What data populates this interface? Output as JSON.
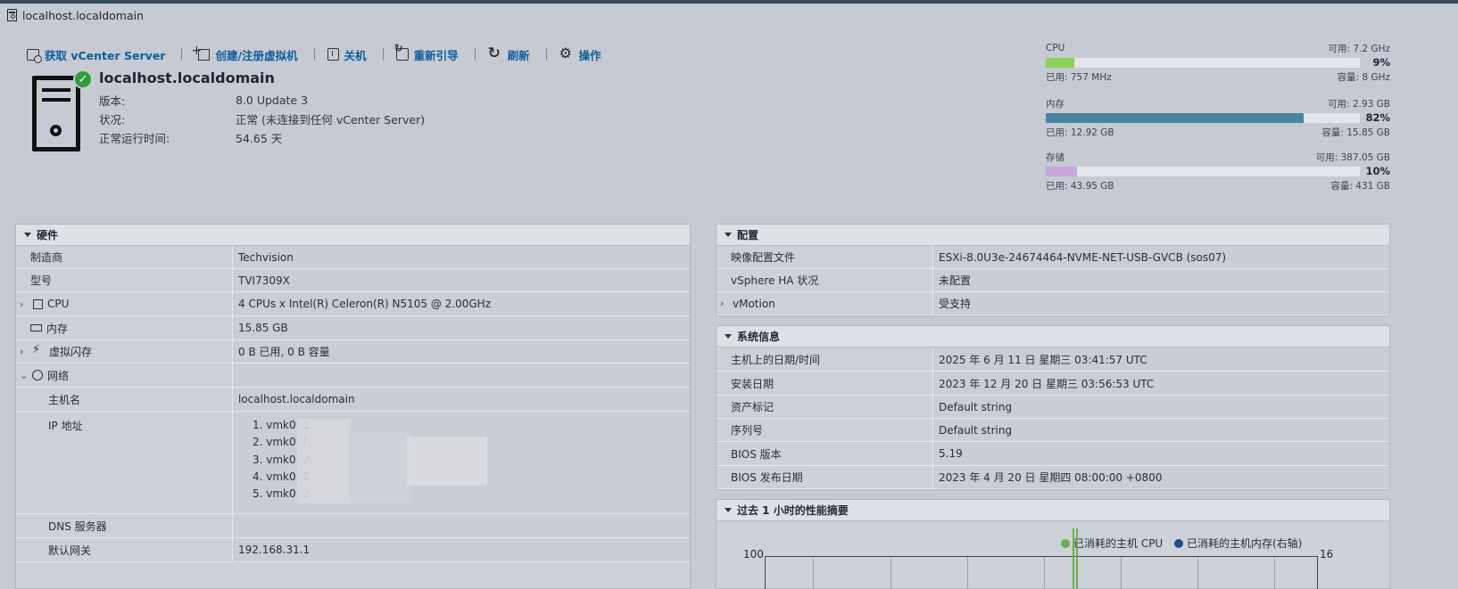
{
  "window": {
    "title": "localhost.localdomain"
  },
  "toolbar": {
    "get_vcenter": "获取 vCenter Server",
    "create_vm": "创建/注册虚拟机",
    "shutdown": "关机",
    "reboot": "重新引导",
    "refresh": "刷新",
    "actions": "操作"
  },
  "host": {
    "name": "localhost.localdomain",
    "status_color": "#2e9e3a",
    "info": [
      {
        "label": "版本:",
        "value": "8.0 Update 3"
      },
      {
        "label": "状况:",
        "value": "正常 (未连接到任何 vCenter Server)"
      },
      {
        "label": "正常运行时间:",
        "value": "54.65 天"
      }
    ]
  },
  "resources": {
    "cpu": {
      "label": "CPU",
      "free": "可用: 7.2 GHz",
      "percent": 9,
      "percent_label": "9%",
      "used": "已用: 757 MHz",
      "capacity": "容量: 8 GHz",
      "color": "#8bd35a"
    },
    "memory": {
      "label": "内存",
      "free": "可用: 2.93 GB",
      "percent": 82,
      "percent_label": "82%",
      "used": "已用: 12.92 GB",
      "capacity": "容量: 15.85 GB",
      "color": "#4a86a2"
    },
    "storage": {
      "label": "存储",
      "free": "可用: 387.05 GB",
      "percent": 10,
      "percent_label": "10%",
      "used": "已用: 43.95 GB",
      "capacity": "容量: 431 GB",
      "color": "#c8a6dc"
    }
  },
  "hardware": {
    "title": "硬件",
    "rows": {
      "manufacturer": {
        "label": "制造商",
        "value": "Techvision"
      },
      "model": {
        "label": "型号",
        "value": "TVI7309X"
      },
      "cpu": {
        "label": "CPU",
        "value": "4 CPUs x Intel(R) Celeron(R) N5105 @ 2.00GHz"
      },
      "memory": {
        "label": "内存",
        "value": "15.85 GB"
      },
      "flash": {
        "label": "虚拟闪存",
        "value": "0 B 已用, 0 B 容量"
      },
      "network": {
        "label": "网络",
        "value": ""
      },
      "hostname": {
        "label": "主机名",
        "value": "localhost.localdomain"
      },
      "ip": {
        "label": "IP 地址",
        "items": [
          "1. vmk0: 1",
          "2. vmk0: f",
          "3. vmk0: 2",
          "4. vmk0: 2",
          "5. vmk0: 2"
        ]
      },
      "dns": {
        "label": "DNS 服务器",
        "value": ""
      },
      "gateway": {
        "label": "默认网关",
        "value": "192.168.31.1"
      }
    }
  },
  "config": {
    "title": "配置",
    "rows": [
      {
        "label": "映像配置文件",
        "value": "ESXi-8.0U3e-24674464-NVME-NET-USB-GVCB (sos07)"
      },
      {
        "label": "vSphere HA 状况",
        "value": "未配置"
      },
      {
        "label": "vMotion",
        "value": "受支持"
      }
    ]
  },
  "sysinfo": {
    "title": "系统信息",
    "rows": [
      {
        "label": "主机上的日期/时间",
        "value": "2025 年 6 月 11 日 星期三 03:41:57 UTC"
      },
      {
        "label": "安装日期",
        "value": "2023 年 12 月 20 日 星期三 03:56:53 UTC"
      },
      {
        "label": "资产标记",
        "value": "Default string"
      },
      {
        "label": "序列号",
        "value": "Default string"
      },
      {
        "label": "BIOS 版本",
        "value": "5.19"
      },
      {
        "label": "BIOS 发布日期",
        "value": "2023 年 4 月 20 日 星期四 08:00:00 +0800"
      }
    ]
  },
  "performance": {
    "title": "过去 1 小时的性能摘要",
    "legend_cpu": "已消耗的主机 CPU",
    "legend_mem": "已消耗的主机内存(右轴)",
    "cpu_color": "#6ab04c",
    "mem_color": "#1d4e89",
    "y_left_top": "100",
    "y_right_top": "16"
  }
}
